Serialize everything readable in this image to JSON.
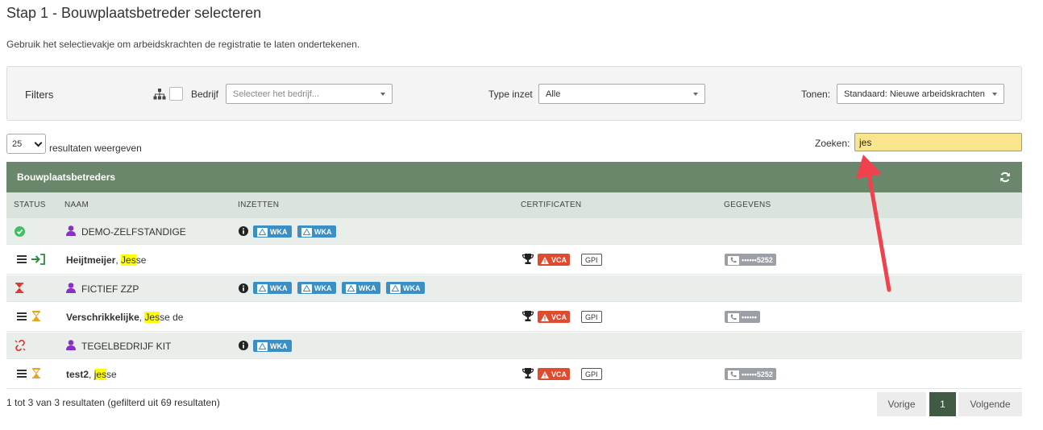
{
  "page": {
    "title": "Stap 1 - Bouwplaatsbetreder selecteren",
    "subtitle": "Gebruik het selectievakje om arbeidskrachten de registratie te laten ondertekenen."
  },
  "filters": {
    "label": "Filters",
    "company_label": "Bedrijf",
    "company_placeholder": "Selecteer het bedrijf...",
    "type_label": "Type inzet",
    "type_value": "Alle",
    "show_label": "Tonen:",
    "show_value": "Standaard: Nieuwe arbeidskrachten"
  },
  "length": {
    "value": "25",
    "label": "resultaten weergeven"
  },
  "search": {
    "label": "Zoeken:",
    "value": "jes"
  },
  "table": {
    "title": "Bouwplaatsbetreders",
    "columns": [
      "STATUS",
      "NAAM",
      "INZETTEN",
      "CERTIFICATEN",
      "GEGEVENS"
    ],
    "rows": [
      {
        "kind": "company",
        "name": "DEMO-ZELFSTANDIGE",
        "status": "check-circle-icon",
        "wka": [
          "WKA",
          "WKA"
        ]
      },
      {
        "kind": "person",
        "last": "Heijtmeijer",
        "first_hl": "Jes",
        "first_rest": "se",
        "status": "enter-arrow-icon",
        "vca": "VCA",
        "gpi": "GPI",
        "phone": "••••••5252"
      },
      {
        "kind": "company",
        "name": "FICTIEF ZZP",
        "status": "hourglass-icon",
        "wka": [
          "WKA",
          "WKA",
          "WKA",
          "WKA"
        ]
      },
      {
        "kind": "person",
        "last": "Verschrikkelijke",
        "first_hl": "Jes",
        "first_rest": "se de",
        "status": "hourglass-icon",
        "vca": "VCA",
        "gpi": "GPI",
        "phone": "••••••"
      },
      {
        "kind": "company",
        "name": "TEGELBEDRIJF KIT",
        "status": "broken-link-icon",
        "wka": [
          "WKA"
        ]
      },
      {
        "kind": "person",
        "last": "test2",
        "first_hl": "jes",
        "first_rest": "se",
        "status": "hourglass-icon",
        "vca": "VCA",
        "gpi": "GPI",
        "phone": "••••••5252"
      }
    ]
  },
  "footer": {
    "info": "1 tot 3 van 3 resultaten (gefilterd uit 69 resultaten)",
    "prev": "Vorige",
    "page": "1",
    "next": "Volgende"
  },
  "colors": {
    "header_green": "#6b876b",
    "active_page": "#405a43",
    "search_bg": "#f8e58c",
    "wka_blue": "#3b8fc4",
    "vca_red": "#e04b30",
    "person_icon": "#8b2fc9",
    "arrow": "#f0424e"
  }
}
